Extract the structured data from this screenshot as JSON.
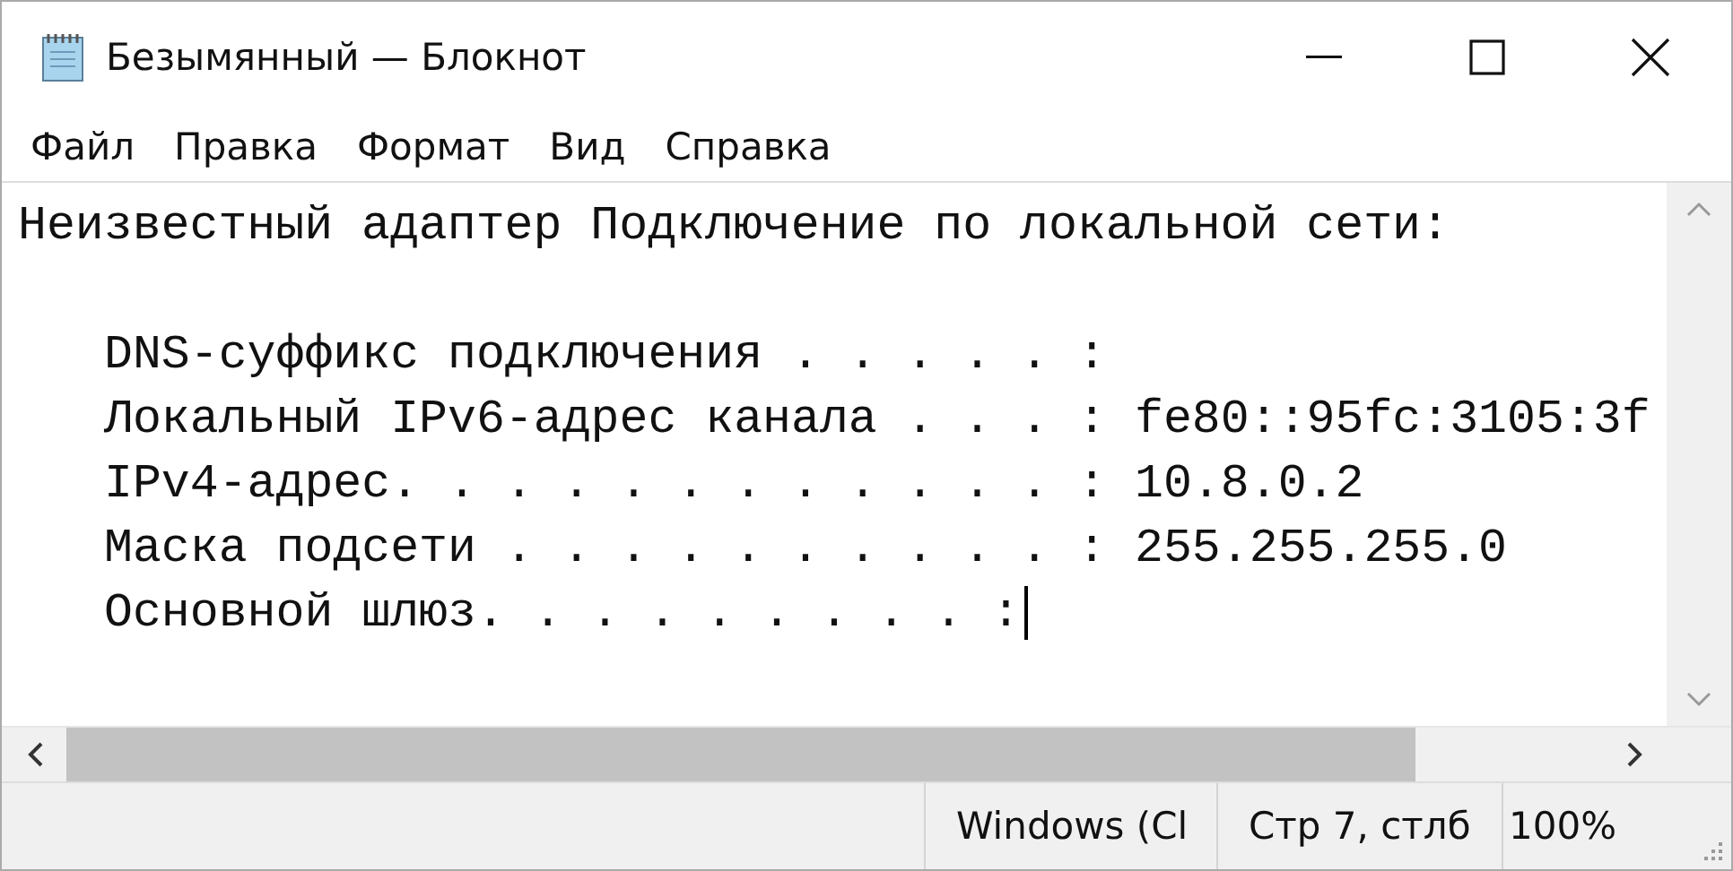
{
  "window": {
    "title": "Безымянный — Блокнот"
  },
  "menu": [
    "Файл",
    "Правка",
    "Формат",
    "Вид",
    "Справка"
  ],
  "editor": {
    "blocks": [
      {
        "indented": false,
        "lines": [
          "Неизвестный адаптер Подключение по локальной сети:"
        ]
      },
      {
        "indented": true,
        "lines": [
          "DNS-суффикс подключения . . . . . :",
          "Локальный IPv6-адрес канала . . . : fe80::95fc:3105:3f",
          "IPv4-адрес. . . . . . . . . . . . : 10.8.0.2",
          "Маска подсети . . . . . . . . . . : 255.255.255.0",
          "Основной шлюз. . . . . . . . . :"
        ]
      }
    ]
  },
  "status_bar": [
    "Windows (Cl",
    "Стр 7, стлб",
    "100%"
  ]
}
